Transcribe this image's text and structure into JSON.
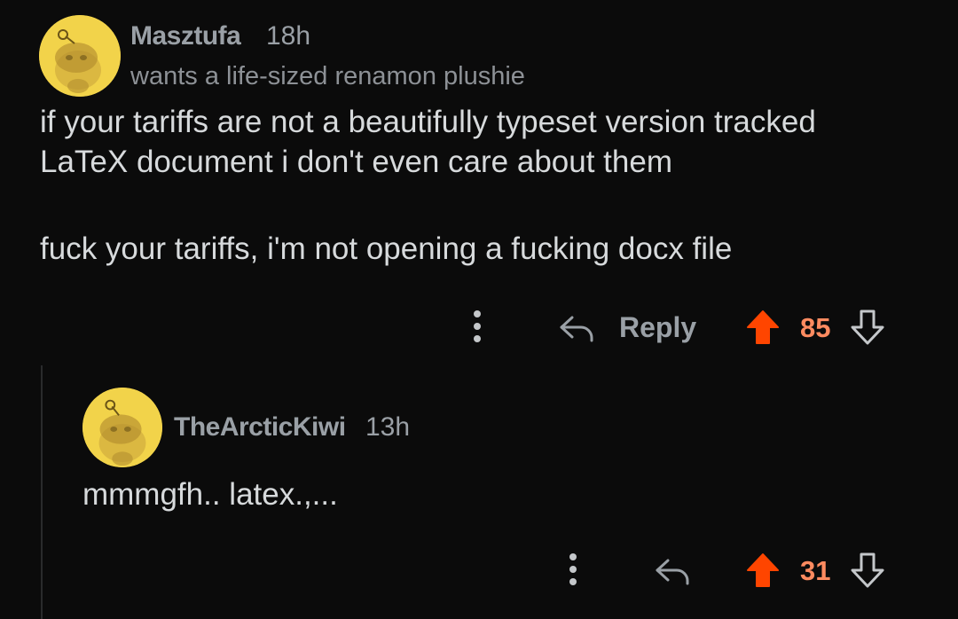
{
  "comments": [
    {
      "username": "Masztufa",
      "time": "18h",
      "flair": "wants a life-sized renamon plushie",
      "body_lines": [
        "if your tariffs are not a beautifully typeset version tracked",
        "LaTeX document i don't even care about them",
        "fuck your tariffs, i'm not opening a fucking docx file"
      ],
      "reply_label": "Reply",
      "score": "85",
      "vote_state": "upvoted"
    },
    {
      "username": "TheArcticKiwi",
      "time": "13h",
      "body_lines": [
        "mmmgfh.. latex.,..."
      ],
      "score": "31",
      "vote_state": "upvoted"
    }
  ],
  "colors": {
    "background": "#0b0b0b",
    "text": "#d7dadc",
    "meta": "#9aa0a6",
    "upvote": "#ff4500",
    "score": "#ff8b60",
    "avatar": "#f2d34a"
  },
  "icons": {
    "more": "vertical-ellipsis-icon",
    "reply": "reply-arrow-icon",
    "upvote": "upvote-arrow-icon",
    "downvote": "downvote-arrow-icon"
  }
}
